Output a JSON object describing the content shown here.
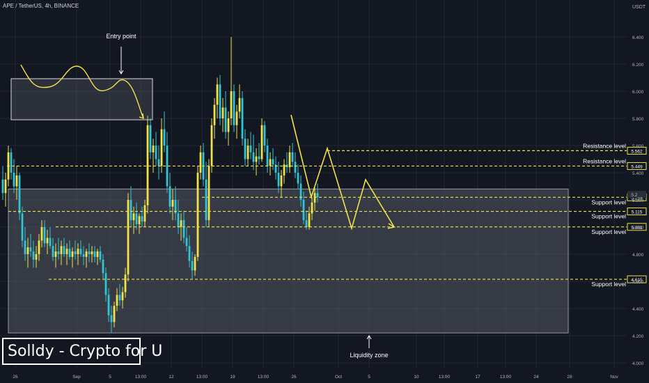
{
  "header": {
    "symbol_line": "APE / TetherUS, 4h, BINANCE"
  },
  "brand": {
    "text": "Solldy - Crypto for U"
  },
  "colors": {
    "background": "#131722",
    "grid": "#1f2430",
    "candle_up": "#f2e24a",
    "candle_down": "#31c4d6",
    "level_line": "#f0e34a",
    "annotation_text": "#ffffff",
    "zone_fill": "rgba(120,123,134,0.35)",
    "zone_border": "#9598a1",
    "drawing": "#f2e24a"
  },
  "chart_data": {
    "type": "candlestick",
    "title": "APE / TetherUS, 4h, BINANCE",
    "price_scale": {
      "unit": "USDT",
      "min": 4.0,
      "max": 6.6,
      "ticks": [
        "6.400",
        "6.200",
        "6.000",
        "5.800",
        "5.600",
        "5.400",
        "5.200",
        "5.000",
        "4.800",
        "4.600",
        "4.400",
        "4.200",
        "4.000"
      ],
      "tick_values": [
        6.4,
        6.2,
        6.0,
        5.8,
        5.6,
        5.4,
        5.2,
        5.0,
        4.8,
        4.6,
        4.4,
        4.2,
        4.0
      ],
      "current_price_label": "5.2__"
    },
    "time_axis": {
      "labels": [
        "26",
        "Sep",
        "5",
        "13:00",
        "12",
        "13:00",
        "19",
        "13:00",
        "26",
        "Oct",
        "5",
        "10",
        "13:00",
        "17",
        "13:00",
        "24",
        "28",
        "Nov"
      ],
      "label_bars": [
        5,
        27,
        39,
        50,
        61,
        72,
        83,
        94,
        105,
        121,
        132,
        149,
        159,
        171,
        181,
        192,
        204,
        220
      ]
    },
    "bars": [
      [
        5.35,
        5.45,
        5.2,
        5.25
      ],
      [
        5.25,
        5.4,
        5.15,
        5.35
      ],
      [
        5.35,
        5.6,
        5.3,
        5.55
      ],
      [
        5.55,
        5.58,
        5.35,
        5.4
      ],
      [
        5.4,
        5.5,
        5.25,
        5.3
      ],
      [
        5.3,
        5.45,
        5.2,
        5.38
      ],
      [
        5.38,
        5.4,
        5.05,
        5.1
      ],
      [
        5.1,
        5.15,
        4.85,
        4.9
      ],
      [
        4.9,
        5.0,
        4.75,
        4.8
      ],
      [
        4.8,
        4.92,
        4.7,
        4.85
      ],
      [
        4.85,
        4.95,
        4.78,
        4.82
      ],
      [
        4.82,
        4.9,
        4.7,
        4.76
      ],
      [
        4.76,
        4.86,
        4.7,
        4.8
      ],
      [
        4.8,
        4.95,
        4.75,
        4.9
      ],
      [
        4.9,
        5.05,
        4.85,
        5.0
      ],
      [
        5.0,
        5.05,
        4.85,
        4.88
      ],
      [
        4.88,
        4.98,
        4.8,
        4.92
      ],
      [
        4.92,
        5.0,
        4.84,
        4.86
      ],
      [
        4.86,
        4.92,
        4.75,
        4.78
      ],
      [
        4.78,
        4.88,
        4.7,
        4.82
      ],
      [
        4.82,
        4.92,
        4.76,
        4.8
      ],
      [
        4.8,
        4.9,
        4.72,
        4.86
      ],
      [
        4.86,
        4.92,
        4.78,
        4.8
      ],
      [
        4.8,
        4.88,
        4.72,
        4.84
      ],
      [
        4.84,
        4.9,
        4.76,
        4.78
      ],
      [
        4.78,
        4.85,
        4.7,
        4.82
      ],
      [
        4.82,
        4.9,
        4.76,
        4.8
      ],
      [
        4.8,
        4.88,
        4.72,
        4.84
      ],
      [
        4.84,
        4.9,
        4.78,
        4.8
      ],
      [
        4.8,
        4.86,
        4.72,
        4.78
      ],
      [
        4.78,
        4.84,
        4.7,
        4.82
      ],
      [
        4.82,
        4.88,
        4.74,
        4.8
      ],
      [
        4.8,
        4.86,
        4.74,
        4.82
      ],
      [
        4.82,
        4.86,
        4.74,
        4.78
      ],
      [
        4.78,
        4.84,
        4.72,
        4.82
      ],
      [
        4.82,
        4.86,
        4.74,
        4.76
      ],
      [
        4.76,
        4.8,
        4.62,
        4.66
      ],
      [
        4.66,
        4.7,
        4.45,
        4.5
      ],
      [
        4.5,
        4.55,
        4.3,
        4.35
      ],
      [
        4.35,
        4.42,
        4.22,
        4.3
      ],
      [
        4.3,
        4.45,
        4.26,
        4.42
      ],
      [
        4.42,
        4.55,
        4.38,
        4.5
      ],
      [
        4.5,
        4.58,
        4.42,
        4.46
      ],
      [
        4.46,
        4.56,
        4.4,
        4.52
      ],
      [
        4.52,
        4.7,
        4.48,
        4.65
      ],
      [
        4.65,
        5.25,
        4.6,
        5.2
      ],
      [
        5.2,
        5.3,
        5.0,
        5.05
      ],
      [
        5.05,
        5.15,
        4.95,
        5.1
      ],
      [
        5.1,
        5.18,
        4.98,
        5.02
      ],
      [
        5.02,
        5.1,
        4.95,
        5.08
      ],
      [
        5.08,
        5.15,
        5.0,
        5.04
      ],
      [
        5.04,
        5.2,
        5.0,
        5.16
      ],
      [
        5.16,
        5.82,
        5.1,
        5.75
      ],
      [
        5.75,
        5.8,
        5.5,
        5.55
      ],
      [
        5.55,
        5.65,
        5.4,
        5.6
      ],
      [
        5.6,
        5.7,
        5.45,
        5.5
      ],
      [
        5.5,
        5.6,
        5.35,
        5.45
      ],
      [
        5.45,
        5.8,
        5.4,
        5.72
      ],
      [
        5.72,
        5.85,
        5.55,
        5.6
      ],
      [
        5.6,
        5.7,
        5.25,
        5.3
      ],
      [
        5.3,
        5.4,
        5.1,
        5.15
      ],
      [
        5.15,
        5.28,
        5.05,
        5.2
      ],
      [
        5.2,
        5.3,
        5.05,
        5.1
      ],
      [
        5.1,
        5.2,
        4.95,
        5.0
      ],
      [
        5.0,
        5.1,
        4.9,
        5.05
      ],
      [
        5.05,
        5.12,
        4.88,
        4.92
      ],
      [
        4.92,
        5.0,
        4.82,
        4.86
      ],
      [
        4.86,
        4.94,
        4.7,
        4.75
      ],
      [
        4.75,
        4.82,
        4.62,
        4.68
      ],
      [
        4.68,
        4.8,
        4.64,
        4.78
      ],
      [
        4.78,
        5.45,
        4.75,
        5.4
      ],
      [
        5.4,
        5.6,
        5.35,
        5.55
      ],
      [
        5.55,
        5.62,
        5.3,
        5.35
      ],
      [
        5.35,
        5.48,
        5.0,
        5.05
      ],
      [
        5.05,
        5.5,
        5.0,
        5.45
      ],
      [
        5.45,
        5.8,
        5.4,
        5.75
      ],
      [
        5.75,
        5.95,
        5.65,
        5.9
      ],
      [
        5.9,
        6.1,
        5.8,
        6.05
      ],
      [
        6.05,
        6.12,
        5.75,
        5.8
      ],
      [
        5.8,
        5.95,
        5.7,
        5.88
      ],
      [
        5.88,
        6.0,
        5.65,
        5.7
      ],
      [
        5.7,
        5.85,
        5.6,
        5.8
      ],
      [
        5.8,
        6.4,
        5.75,
        6.0
      ],
      [
        6.0,
        6.05,
        5.7,
        5.75
      ],
      [
        5.75,
        5.9,
        5.65,
        5.85
      ],
      [
        5.85,
        6.05,
        5.8,
        5.95
      ],
      [
        5.95,
        6.0,
        5.6,
        5.65
      ],
      [
        5.65,
        5.72,
        5.45,
        5.5
      ],
      [
        5.5,
        5.65,
        5.45,
        5.6
      ],
      [
        5.6,
        5.7,
        5.5,
        5.55
      ],
      [
        5.55,
        5.68,
        5.42,
        5.48
      ],
      [
        5.48,
        5.58,
        5.38,
        5.52
      ],
      [
        5.52,
        5.62,
        5.46,
        5.5
      ],
      [
        5.5,
        5.8,
        5.48,
        5.75
      ],
      [
        5.75,
        5.78,
        5.55,
        5.6
      ],
      [
        5.6,
        5.65,
        5.4,
        5.45
      ],
      [
        5.45,
        5.55,
        5.38,
        5.5
      ],
      [
        5.5,
        5.58,
        5.42,
        5.46
      ],
      [
        5.46,
        5.52,
        5.35,
        5.4
      ],
      [
        5.4,
        5.48,
        5.25,
        5.3
      ],
      [
        5.3,
        5.42,
        5.22,
        5.38
      ],
      [
        5.38,
        5.5,
        5.32,
        5.46
      ],
      [
        5.46,
        5.55,
        5.4,
        5.44
      ],
      [
        5.44,
        5.6,
        5.4,
        5.55
      ],
      [
        5.55,
        5.62,
        5.44,
        5.48
      ],
      [
        5.48,
        5.55,
        5.36,
        5.4
      ],
      [
        5.4,
        5.46,
        5.28,
        5.32
      ],
      [
        5.32,
        5.38,
        5.15,
        5.2
      ],
      [
        5.2,
        5.26,
        5.02,
        5.05
      ],
      [
        5.05,
        5.12,
        4.98,
        5.0
      ],
      [
        5.0,
        5.15,
        4.98,
        5.1
      ],
      [
        5.1,
        5.22,
        5.05,
        5.18
      ],
      [
        5.18,
        5.3,
        5.12,
        5.25
      ],
      [
        5.25,
        5.32,
        5.18,
        5.22
      ]
    ],
    "levels": [
      {
        "label": "Resistance level",
        "price": 5.562,
        "price_label": "5.562"
      },
      {
        "label": "Resistance level",
        "price": 5.449,
        "price_label": "5.449"
      },
      {
        "label": "Support level",
        "price": 5.219,
        "price_label": "5.219"
      },
      {
        "label": "Support level",
        "price": 5.115,
        "price_label": "5.115"
      },
      {
        "label": "Support level",
        "price": 5.001,
        "price_label": "5.001"
      },
      {
        "label": "Support level",
        "price": 4.615,
        "price_label": "4.615"
      }
    ],
    "liquidity_zone": {
      "label": "Liquidity zone",
      "price_top": 5.28,
      "price_bottom": 4.22
    },
    "entry_box": {
      "label": "Entry point"
    },
    "grid": true
  }
}
